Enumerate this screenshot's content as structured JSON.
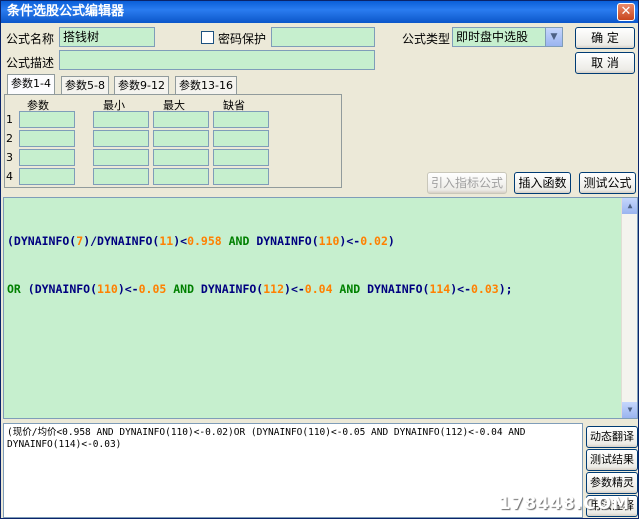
{
  "window": {
    "title": "条件选股公式编辑器",
    "close_label": "✕"
  },
  "form": {
    "name_label": "公式名称",
    "name_value": "搭钱树",
    "password_label": "密码保护",
    "password_value": "",
    "type_label": "公式类型",
    "type_value": "即时盘中选股",
    "desc_label": "公式描述",
    "desc_value": ""
  },
  "buttons": {
    "ok": "确  定",
    "cancel": "取  消",
    "import": "引入指标公式",
    "insert_func": "插入函数",
    "test": "测试公式"
  },
  "tabs": [
    "参数1-4",
    "参数5-8",
    "参数9-12",
    "参数13-16"
  ],
  "params": {
    "headers": [
      "参数",
      "最小",
      "最大",
      "缺省"
    ],
    "rows": [
      "1",
      "2",
      "3",
      "4"
    ]
  },
  "editor": {
    "line1": [
      {
        "t": "(DYNAINFO(",
        "c": "op"
      },
      {
        "t": "7",
        "c": "num"
      },
      {
        "t": ")/DYNAINFO(",
        "c": "op"
      },
      {
        "t": "11",
        "c": "num"
      },
      {
        "t": ")<",
        "c": "op"
      },
      {
        "t": "0.958",
        "c": "num"
      },
      {
        "t": " AND ",
        "c": "kw"
      },
      {
        "t": "DYNAINFO(",
        "c": "op"
      },
      {
        "t": "110",
        "c": "num"
      },
      {
        "t": ")<-",
        "c": "op"
      },
      {
        "t": "0.02",
        "c": "num"
      },
      {
        "t": ")",
        "c": "op"
      }
    ],
    "line2": [
      {
        "t": "OR ",
        "c": "kw"
      },
      {
        "t": "(DYNAINFO(",
        "c": "op"
      },
      {
        "t": "110",
        "c": "num"
      },
      {
        "t": ")<-",
        "c": "op"
      },
      {
        "t": "0.05",
        "c": "num"
      },
      {
        "t": " AND ",
        "c": "kw"
      },
      {
        "t": "DYNAINFO(",
        "c": "op"
      },
      {
        "t": "112",
        "c": "num"
      },
      {
        "t": ")<-",
        "c": "op"
      },
      {
        "t": "0.04",
        "c": "num"
      },
      {
        "t": " AND ",
        "c": "kw"
      },
      {
        "t": "DYNAINFO(",
        "c": "op"
      },
      {
        "t": "114",
        "c": "num"
      },
      {
        "t": ")<-",
        "c": "op"
      },
      {
        "t": "0.03",
        "c": "num"
      },
      {
        "t": ");",
        "c": "op"
      }
    ]
  },
  "output": {
    "text": "(现价/均价<0.958 AND DYNAINFO(110)<-0.02)OR (DYNAINFO(110)<-0.05 AND DYNAINFO(112)<-0.04 AND\nDYNAINFO(114)<-0.03)"
  },
  "side_buttons": [
    "动态翻译",
    "测试结果",
    "参数精灵",
    "用法注释"
  ],
  "watermark": "178448.COM",
  "colors": {
    "accent": "#0a5fd8",
    "field_green": "#c6efce",
    "keyword": "#008000",
    "number": "#ff8000"
  }
}
